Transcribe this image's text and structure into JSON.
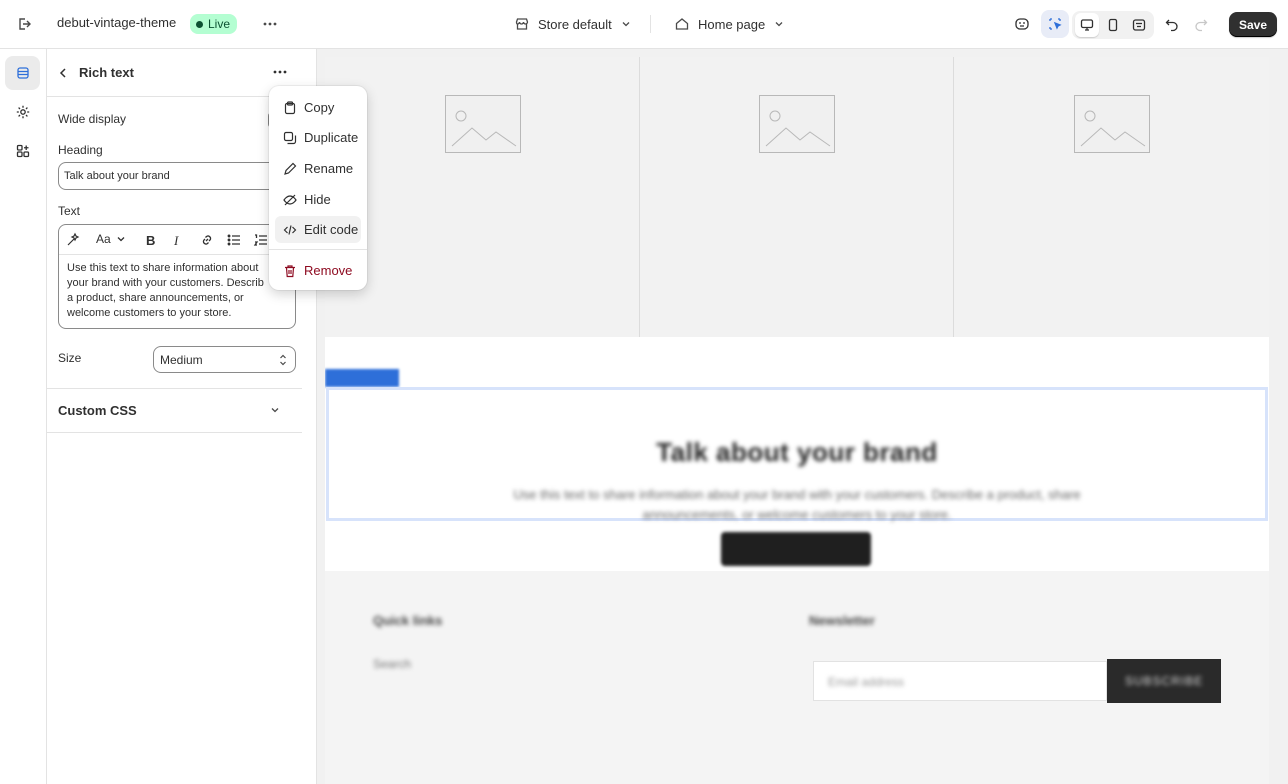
{
  "topbar": {
    "theme_name": "debut-vintage-theme",
    "live_label": "Live",
    "store_label": "Store default",
    "page_label": "Home page",
    "save_label": "Save"
  },
  "panel": {
    "title": "Rich text",
    "wide_display_label": "Wide display",
    "heading_label": "Heading",
    "heading_value": "Talk about your brand",
    "text_label": "Text",
    "text_lines": [
      "Use this text to share information about",
      "your brand with your customers. Describ",
      "a product, share announcements, or",
      "welcome customers to your store."
    ],
    "size_label": "Size",
    "size_value": "Medium",
    "custom_css_label": "Custom CSS"
  },
  "context_menu": {
    "items": [
      "Copy",
      "Duplicate",
      "Rename",
      "Hide",
      "Edit code"
    ],
    "remove_label": "Remove"
  },
  "preview": {
    "rich_heading": "Talk about your brand",
    "rich_body": "Use this text to share information about your brand with your customers. Describe a product, share announcements, or welcome customers to your store.",
    "footer_links_title": "Quick links",
    "footer_search": "Search",
    "footer_newsletter_title": "Newsletter",
    "email_placeholder": "Email address",
    "subscribe_label": "SUBSCRIBE"
  },
  "colors": {
    "accent": "#2e6fd9",
    "live_bg": "#b4fed2",
    "danger": "#8e0b21",
    "save_bg": "#303030"
  }
}
